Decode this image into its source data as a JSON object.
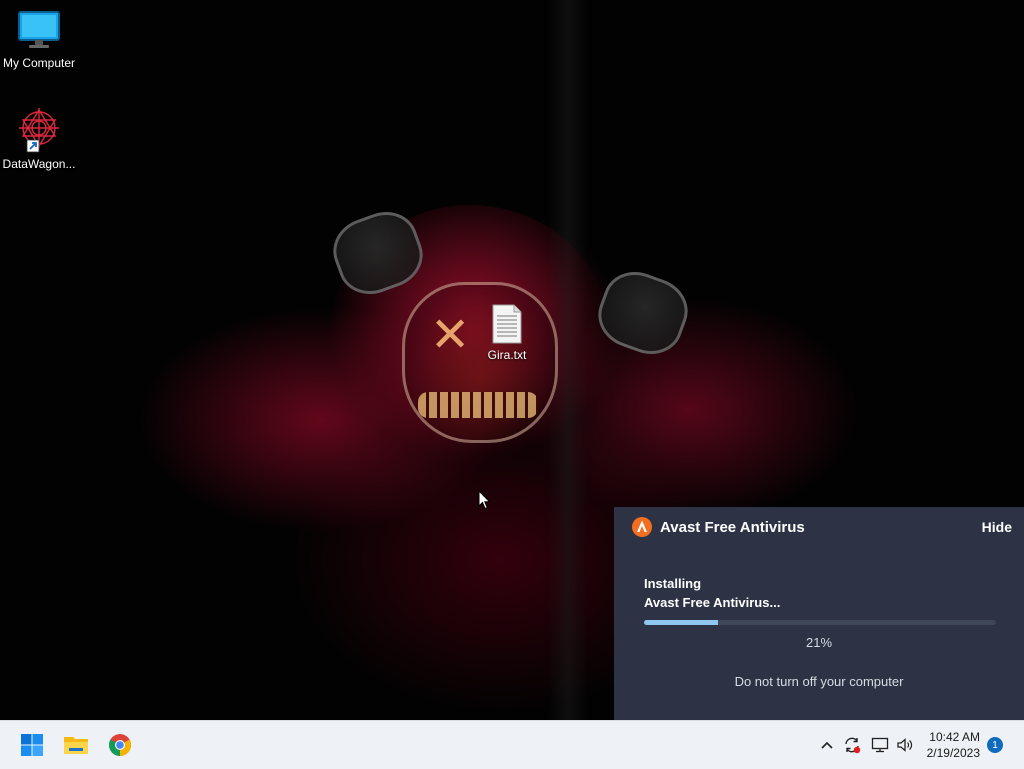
{
  "desktop": {
    "icons": [
      {
        "label": "My Computer",
        "icon": "monitor-icon"
      },
      {
        "label": "DataWagon...",
        "icon": "datawagon-shortcut-icon"
      },
      {
        "label": "Gira.txt",
        "icon": "text-file-icon"
      }
    ]
  },
  "avast": {
    "title": "Avast Free Antivirus",
    "hide_label": "Hide",
    "status_line1": "Installing",
    "status_line2": "Avast Free Antivirus...",
    "progress_percent": 21,
    "progress_text": "21%",
    "warning": "Do not turn off your computer",
    "accent_color": "#f26f21",
    "panel_color": "#2d3345",
    "progress_color": "#8ec6f0"
  },
  "taskbar": {
    "apps": [
      "start-icon",
      "file-explorer-icon",
      "chrome-icon"
    ],
    "tray_icons": [
      "chevron-up-icon",
      "sync-alert-icon",
      "network-icon",
      "volume-icon"
    ],
    "time": "10:42 AM",
    "date": "2/19/2023",
    "notification_count": "1"
  }
}
